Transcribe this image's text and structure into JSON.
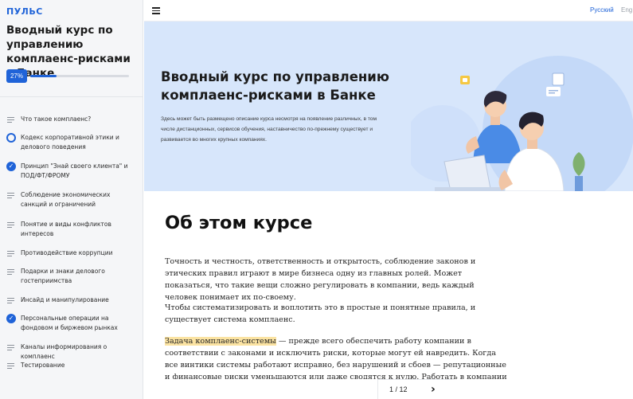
{
  "brand": {
    "logo": "ПУЛЬС"
  },
  "course": {
    "title": "Вводный курс по управлению комплаенс-рисками в Банке",
    "progress_label": "27%",
    "progress": 0.27
  },
  "menu": [
    {
      "label": "Что такое комплаенс?",
      "state": "text"
    },
    {
      "label": "Кодекс корпоративной этики и делового поведения",
      "state": "current"
    },
    {
      "label": "Принцип \"Знай своего клиента\" и ПОД/ФТ/ФРОМУ",
      "state": "done"
    },
    {
      "label": "Соблюдение экономических санкций и ограничений",
      "state": "text"
    },
    {
      "label": "Понятие и виды конфликтов интересов",
      "state": "text"
    },
    {
      "label": "Противодействие коррупции",
      "state": "text"
    },
    {
      "label": "Подарки и знаки делового гостеприимства",
      "state": "text"
    },
    {
      "label": "Инсайд и манипулирование",
      "state": "text"
    },
    {
      "label": "Персональные операции на фондовом и биржевом рынках",
      "state": "done"
    },
    {
      "label": "Каналы информирования о комплаенс",
      "state": "text"
    },
    {
      "label": "Тестирование",
      "state": "text"
    }
  ],
  "topbar": {
    "lang_ru": "Русский",
    "lang_en": "Eng"
  },
  "hero": {
    "title": "Вводный курс по управлению комплаенс-рисками в Банке",
    "description": "Здесь может быть размещено описание курса несмотря на появление различных, в том числе дистанционных, сервисов обучения, наставничество по-прежнему существует и развивается во многих крупных компаниях."
  },
  "about": {
    "title": "Об этом курсе",
    "p1": "Точность и честность, ответственность и открытость, соблюдение законов и этических правил играют в мире бизнеса одну из главных ролей. Может показаться, что такие вещи сложно регулировать в компании, ведь каждый человек понимает их по-своему.",
    "p2": "Чтобы систематизировать и воплотить это в простые и понятные правила, и существует система комплаенс.",
    "p3_highlight": "Задача комплаенс-системы",
    "p3_rest": " — прежде всего обеспечить работу компании в соответствии с законами и исключить риски, которые могут ей навредить. Когда все винтики системы работают исправно, без нарушений и сбоев — репутационные и финансовые риски уменьшаются или даже сводятся к нулю. Работать в компании становится комфортно, а"
  },
  "pager": {
    "label": "1 / 12"
  },
  "colors": {
    "accent": "#1f63d8",
    "hero_bg": "#d7e6fb",
    "highlight": "#fbe3a2"
  }
}
